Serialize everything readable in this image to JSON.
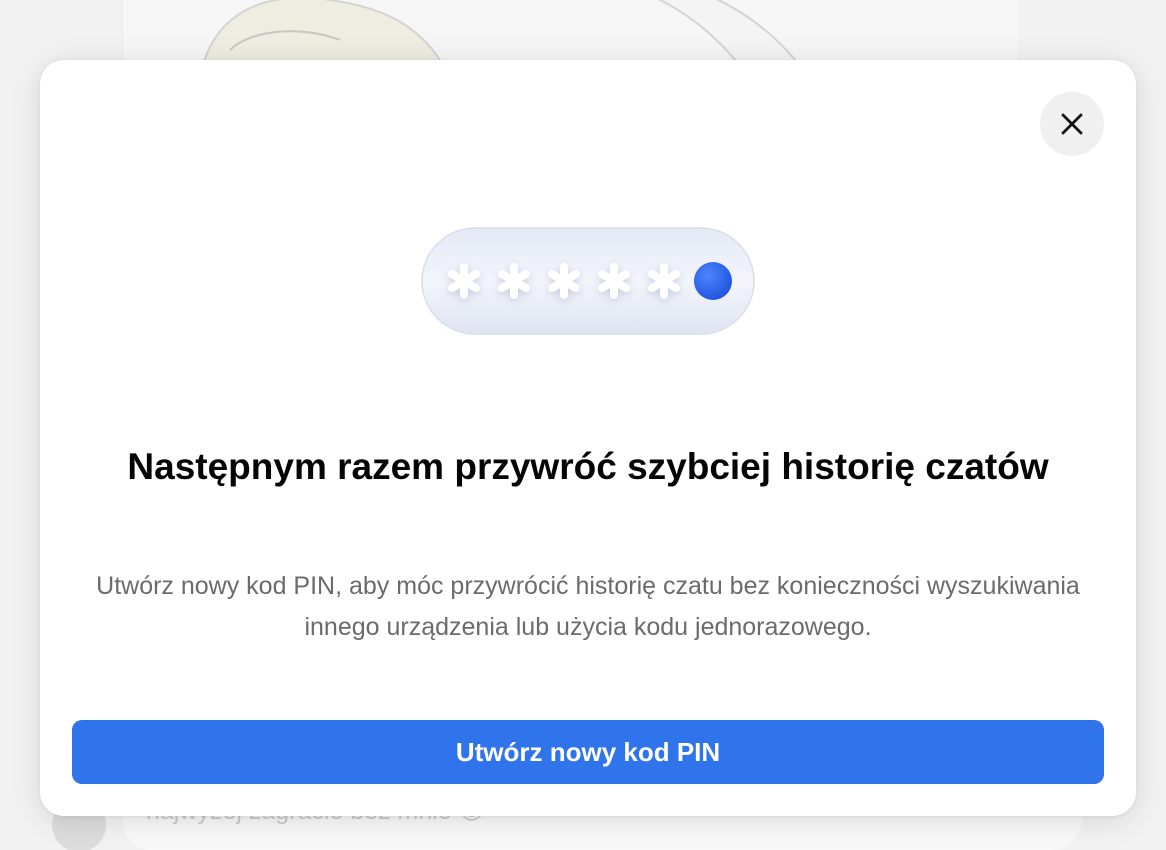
{
  "background": {
    "message_preview": "najwyżej zagracie bez mnie 😊"
  },
  "modal": {
    "title": "Następnym razem przywróć szybciej historię czatów",
    "description": "Utwórz nowy kod PIN, aby móc przywrócić historię czatu bez konieczności wyszukiwania innego urządzenia lub użycia kodu jednorazowego.",
    "primary_button_label": "Utwórz nowy kod PIN",
    "close_icon": "close-icon",
    "illustration_icon": "pin-code-illustration",
    "masked_digits_count": 5
  },
  "colors": {
    "accent": "#2f74ea",
    "pin_dot": "#2a62ee",
    "title": "#050505",
    "description": "#6b6b6f"
  }
}
